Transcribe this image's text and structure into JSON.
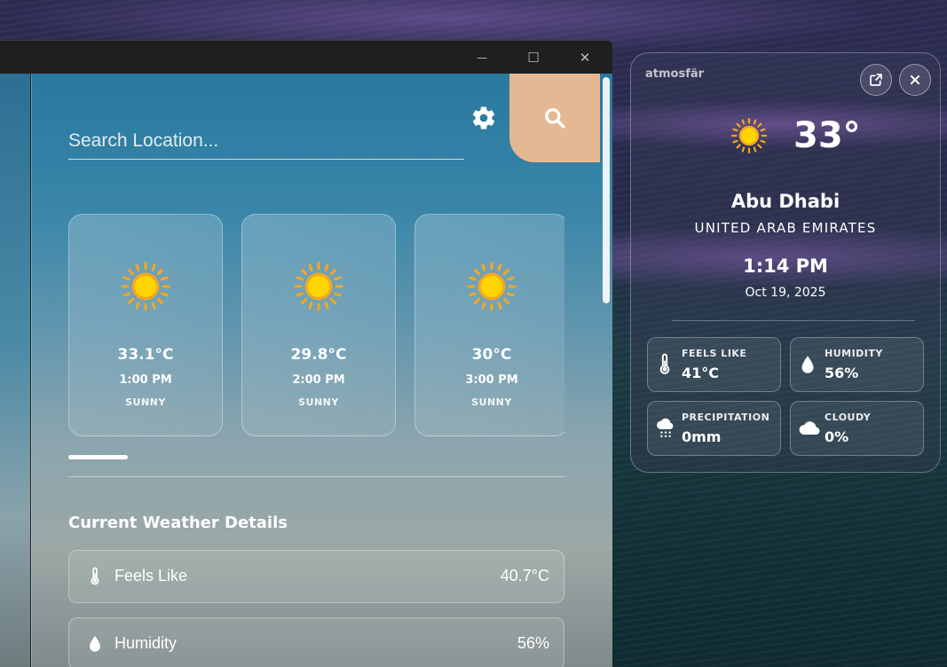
{
  "window": {
    "minimize_glyph": "—",
    "maximize_glyph": "☐",
    "close_glyph": "✕"
  },
  "search": {
    "placeholder": "Search Location..."
  },
  "forecast": [
    {
      "temp": "33.1°C",
      "time": "1:00 PM",
      "condition": "SUNNY",
      "icon": "sun-icon"
    },
    {
      "temp": "29.8°C",
      "time": "2:00 PM",
      "condition": "SUNNY",
      "icon": "sun-icon"
    },
    {
      "temp": "30°C",
      "time": "3:00 PM",
      "condition": "SUNNY",
      "icon": "sun-icon"
    }
  ],
  "details": {
    "title": "Current Weather Details",
    "rows": [
      {
        "label": "Feels Like",
        "value": "40.7°C",
        "icon": "thermometer-icon"
      },
      {
        "label": "Humidity",
        "value": "56%",
        "icon": "droplet-icon"
      }
    ]
  },
  "widget": {
    "brand": "atmosfär",
    "temp": "33°",
    "city": "Abu Dhabi",
    "country": "UNITED ARAB EMIRATES",
    "time": "1:14 PM",
    "date": "Oct 19, 2025",
    "tiles": [
      {
        "label": "FEELS LIKE",
        "value": "41°C",
        "icon": "thermometer-icon"
      },
      {
        "label": "HUMIDITY",
        "value": "56%",
        "icon": "droplet-icon"
      },
      {
        "label": "PRECIPITATION",
        "value": "0mm",
        "icon": "rain-cloud-icon"
      },
      {
        "label": "CLOUDY",
        "value": "0%",
        "icon": "cloud-icon"
      }
    ]
  },
  "colors": {
    "accent": "#e4b892",
    "sun_core": "#ffd500",
    "sun_ring": "#f4a623"
  }
}
